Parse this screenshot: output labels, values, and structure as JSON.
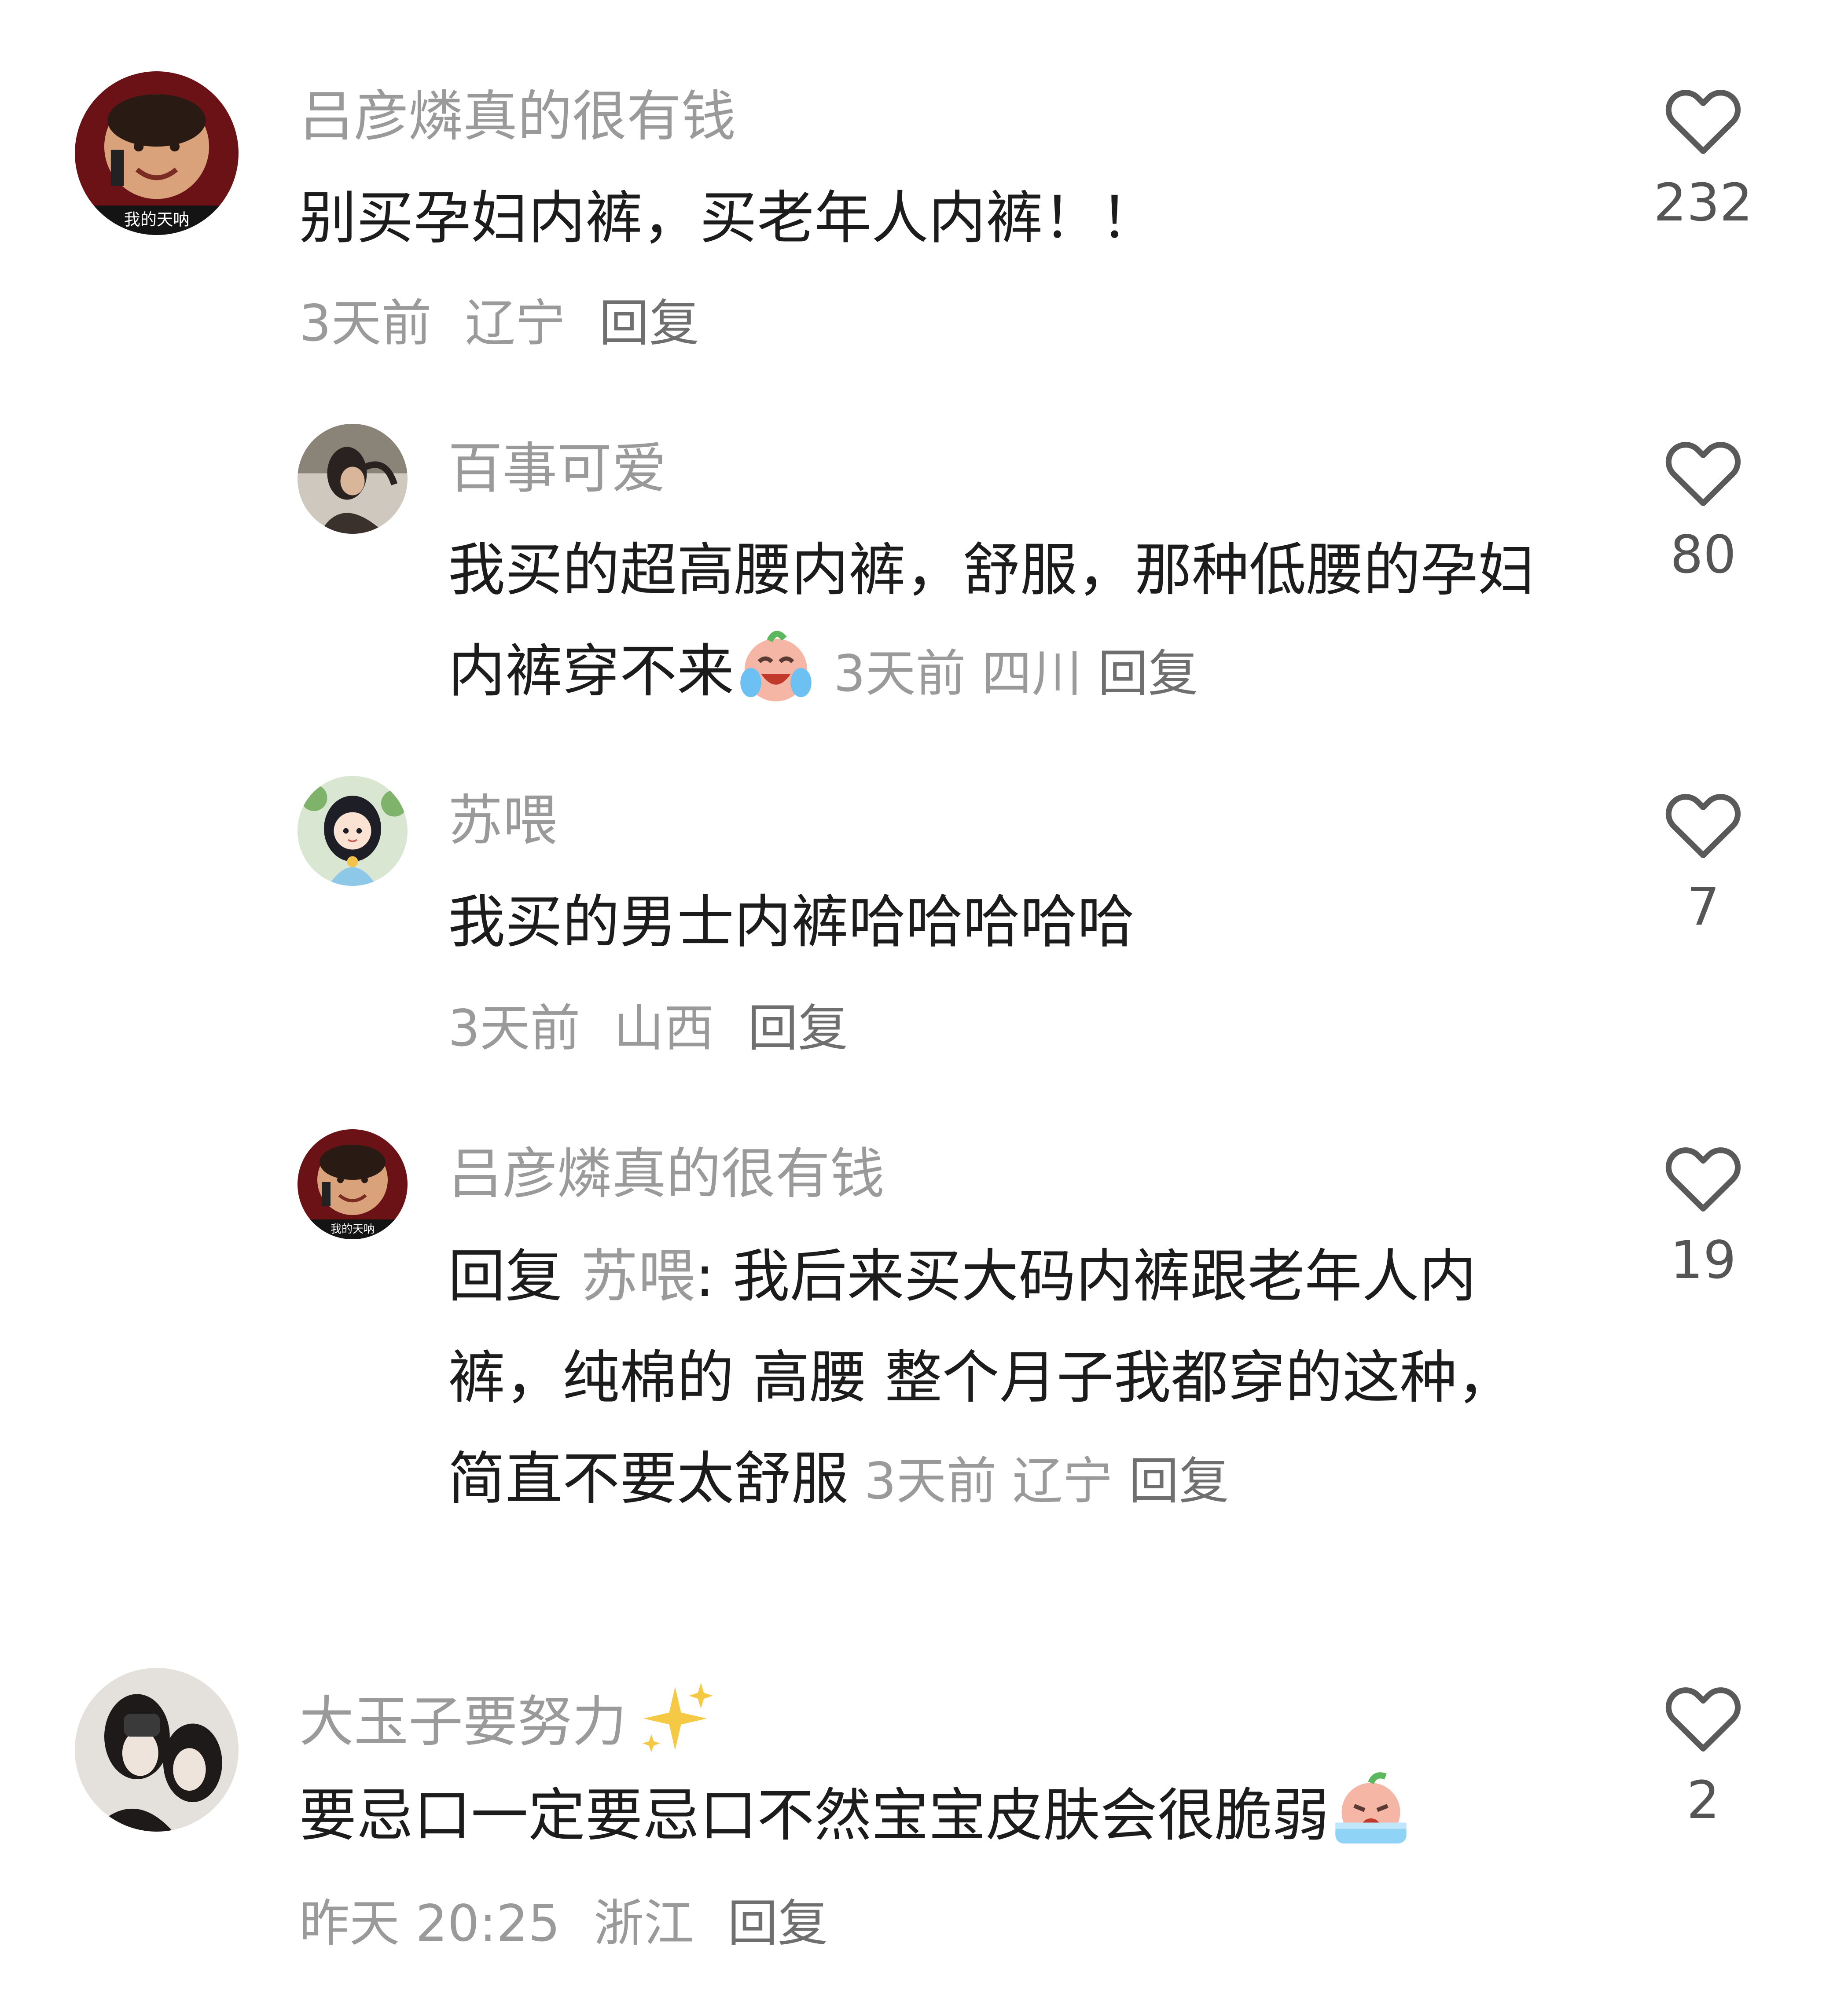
{
  "comments": [
    {
      "username": "吕彦燐真的很有钱",
      "avatar_caption": "我的天呐",
      "text": "别买孕妇内裤，买老年人内裤！！",
      "time": "3天前",
      "location": "辽宁",
      "reply_label": "回复",
      "likes": "232"
    },
    {
      "username": "百事可爱",
      "text": "我买的超高腰内裤，舒服，那种低腰的孕妇内裤穿不来",
      "emoji": "crying-laughing-face",
      "time": "3天前",
      "location": "四川",
      "reply_label": "回复",
      "likes": "80"
    },
    {
      "username": "苏喂",
      "text": "我买的男士内裤哈哈哈哈哈",
      "time": "3天前",
      "location": "山西",
      "reply_label": "回复",
      "likes": "7"
    },
    {
      "username": "吕彦燐真的很有钱",
      "avatar_caption": "我的天呐",
      "reply_prefix": "回复",
      "mention": "苏喂",
      "text": ": 我后来买大码内裤跟老年人内裤，纯棉的 高腰 整个月子我都穿的这种，简直不要太舒服",
      "time": "3天前",
      "location": "辽宁",
      "reply_label": "回复",
      "likes": "19"
    },
    {
      "username": "大玉子要努力",
      "username_emoji": "sparkles",
      "text": "要忌口一定要忌口不然宝宝皮肤会很脆弱",
      "emoji": "crying-face",
      "time": "昨天 20:25",
      "location": "浙江",
      "reply_label": "回复",
      "likes": "2"
    }
  ],
  "colors": {
    "username": "#9a9a9a",
    "text": "#1c1c1c",
    "meta": "#9a9a9a",
    "heart_stroke": "#5a5a5a"
  }
}
